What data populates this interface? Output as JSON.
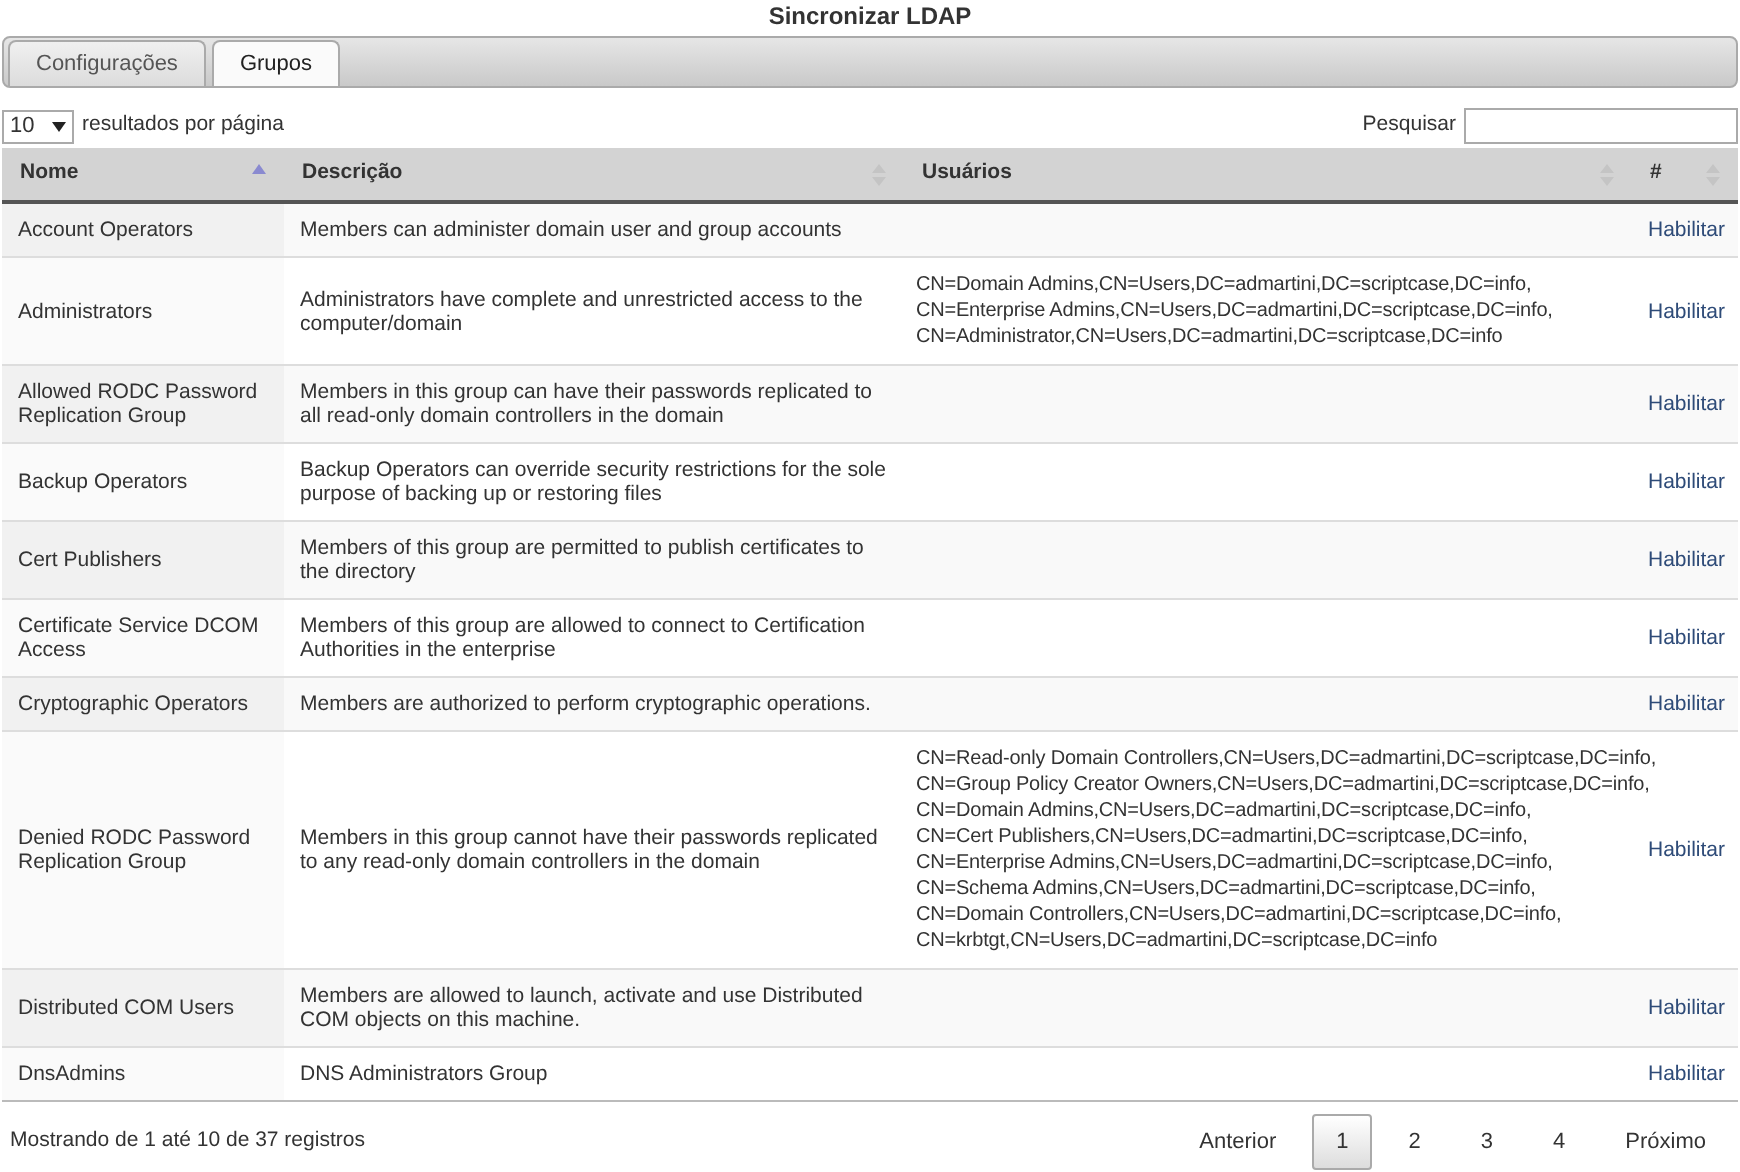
{
  "window": {
    "title": "Sincronizar LDAP"
  },
  "tabs": [
    {
      "label": "Configurações",
      "selected": false
    },
    {
      "label": "Grupos",
      "selected": true
    }
  ],
  "page_length": {
    "value": "10",
    "label": "resultados por página"
  },
  "search": {
    "label": "Pesquisar"
  },
  "table": {
    "columns": [
      {
        "label": "Nome",
        "sorted_ascending": true
      },
      {
        "label": "Descrição",
        "sorted_ascending": false
      },
      {
        "label": "Usuários",
        "sorted_ascending": false
      },
      {
        "label": "#",
        "sorted_ascending": false
      }
    ],
    "rows": [
      {
        "name": "Account Operators",
        "description": "Members can administer domain user and group accounts",
        "users": [],
        "action": "Habilitar"
      },
      {
        "name": "Administrators",
        "description": "Administrators have complete and unrestricted access to the computer/domain",
        "users": [
          "CN=Domain Admins,CN=Users,DC=admartini,DC=scriptcase,DC=info,",
          "CN=Enterprise Admins,CN=Users,DC=admartini,DC=scriptcase,DC=info,",
          "CN=Administrator,CN=Users,DC=admartini,DC=scriptcase,DC=info"
        ],
        "action": "Habilitar"
      },
      {
        "name": "Allowed RODC Password Replication Group",
        "description": "Members in this group can have their passwords replicated to all read-only domain controllers in the domain",
        "users": [],
        "action": "Habilitar"
      },
      {
        "name": "Backup Operators",
        "description": "Backup Operators can override security restrictions for the sole purpose of backing up or restoring files",
        "users": [],
        "action": "Habilitar"
      },
      {
        "name": "Cert Publishers",
        "description": "Members of this group are permitted to publish certificates to the directory",
        "users": [],
        "action": "Habilitar"
      },
      {
        "name": "Certificate Service DCOM Access",
        "description": "Members of this group are allowed to connect to Certification Authorities in the enterprise",
        "users": [],
        "action": "Habilitar"
      },
      {
        "name": "Cryptographic Operators",
        "description": "Members are authorized to perform cryptographic operations.",
        "users": [],
        "action": "Habilitar"
      },
      {
        "name": "Denied RODC Password Replication Group",
        "description": "Members in this group cannot have their passwords replicated to any read-only domain controllers in the domain",
        "users": [
          "CN=Read-only Domain Controllers,CN=Users,DC=admartini,DC=scriptcase,DC=info,",
          "CN=Group Policy Creator Owners,CN=Users,DC=admartini,DC=scriptcase,DC=info,",
          "CN=Domain Admins,CN=Users,DC=admartini,DC=scriptcase,DC=info,",
          "CN=Cert Publishers,CN=Users,DC=admartini,DC=scriptcase,DC=info,",
          "CN=Enterprise Admins,CN=Users,DC=admartini,DC=scriptcase,DC=info,",
          "CN=Schema Admins,CN=Users,DC=admartini,DC=scriptcase,DC=info,",
          "CN=Domain Controllers,CN=Users,DC=admartini,DC=scriptcase,DC=info,",
          "CN=krbtgt,CN=Users,DC=admartini,DC=scriptcase,DC=info"
        ],
        "action": "Habilitar"
      },
      {
        "name": "Distributed COM Users",
        "description": "Members are allowed to launch, activate and use Distributed COM objects on this machine.",
        "users": [],
        "action": "Habilitar"
      },
      {
        "name": "DnsAdmins",
        "description": "DNS Administrators Group",
        "users": [],
        "action": "Habilitar"
      }
    ]
  },
  "info": "Mostrando de 1 até 10 de 37 registros",
  "pagination": {
    "previous": "Anterior",
    "pages": [
      {
        "label": "1",
        "selected": true
      },
      {
        "label": "2",
        "selected": false
      },
      {
        "label": "3",
        "selected": false
      },
      {
        "label": "4",
        "selected": false
      }
    ],
    "next": "Próximo"
  }
}
